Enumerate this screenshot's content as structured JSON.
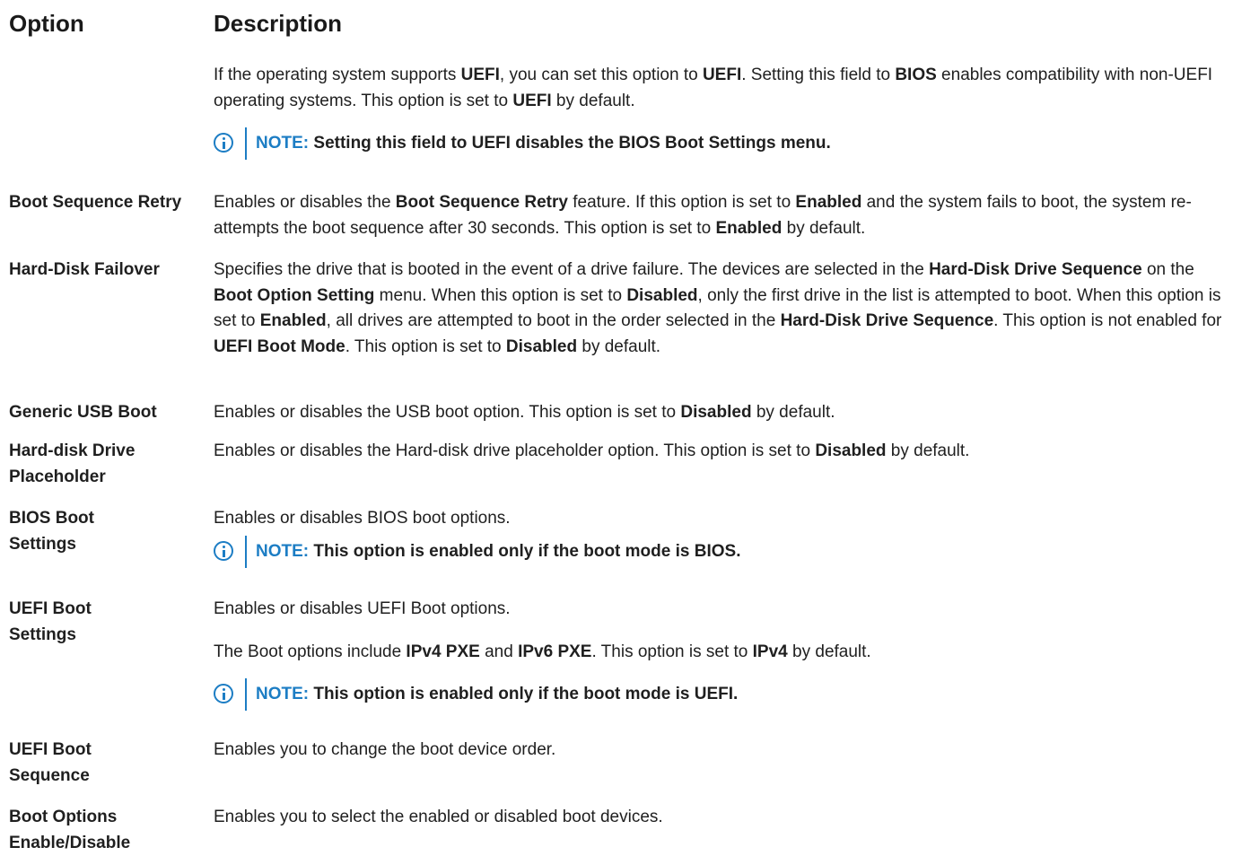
{
  "header": {
    "option": "Option",
    "description": "Description"
  },
  "intro": {
    "p1": [
      "If the operating system supports ",
      "UEFI",
      ", you can set this option to ",
      "UEFI",
      ". Setting this field to ",
      "BIOS",
      " enables compatibility with non-UEFI operating systems. This option is set to ",
      "UEFI",
      " by default."
    ],
    "note": {
      "label": "NOTE:",
      "text": "Setting this field to UEFI disables the BIOS Boot Settings menu."
    }
  },
  "rows": [
    {
      "option": "Boot Sequence Retry",
      "p1": [
        "Enables or disables the ",
        "Boot Sequence Retry",
        " feature. If this option is set to ",
        "Enabled",
        " and the system fails to boot, the system re-attempts the boot sequence after 30 seconds. This option is set to ",
        "Enabled",
        " by default."
      ]
    },
    {
      "option": "Hard-Disk Failover",
      "p1": [
        "Specifies the drive that is booted in the event of a drive failure. The devices are selected in the ",
        "Hard-Disk Drive Sequence",
        " on the ",
        "Boot Option Setting",
        " menu. When this option is set to ",
        "Disabled",
        ", only the first drive in the list is attempted to boot. When this option is set to ",
        "Enabled",
        ", all drives are attempted to boot in the order selected in the ",
        "Hard-Disk Drive Sequence",
        ". This option is not enabled for ",
        "UEFI Boot Mode",
        ". This option is set to ",
        "Disabled",
        " by default."
      ]
    },
    {
      "option": "Generic USB Boot",
      "p1": [
        "Enables or disables the USB boot option. This option is set to ",
        "Disabled",
        " by default."
      ]
    },
    {
      "option": "Hard-disk Drive Placeholder",
      "p1": [
        "Enables or disables the Hard-disk drive placeholder option. This option is set to ",
        "Disabled",
        " by default."
      ]
    },
    {
      "option": "BIOS Boot Settings",
      "p1": [
        "Enables or disables BIOS boot options."
      ],
      "note": {
        "label": "NOTE:",
        "text": "This option is enabled only if the boot mode is BIOS."
      }
    },
    {
      "option": "UEFI Boot Settings",
      "p1": [
        "Enables or disables UEFI Boot options."
      ],
      "p2": [
        "The Boot options include ",
        "IPv4 PXE",
        " and ",
        "IPv6 PXE",
        ". This option is set to ",
        "IPv4",
        " by default."
      ],
      "note": {
        "label": "NOTE:",
        "text": "This option is enabled only if the boot mode is UEFI."
      }
    },
    {
      "option": "UEFI Boot Sequence",
      "p1": [
        "Enables you to change the boot device order."
      ]
    },
    {
      "option": "Boot Options Enable/Disable",
      "p1": [
        "Enables you to select the enabled or disabled boot devices."
      ]
    }
  ]
}
